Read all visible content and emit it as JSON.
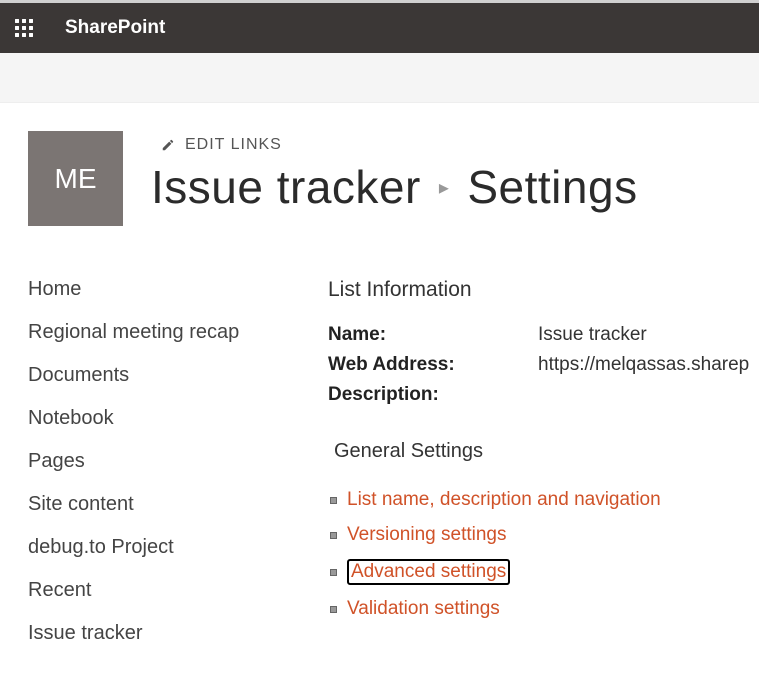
{
  "header": {
    "product_name": "SharePoint"
  },
  "site_logo_text": "ME",
  "edit_links_label": "EDIT LINKS",
  "page_title": {
    "list_name": "Issue tracker",
    "section": "Settings"
  },
  "sidebar": {
    "items": [
      {
        "label": "Home"
      },
      {
        "label": "Regional meeting recap"
      },
      {
        "label": "Documents"
      },
      {
        "label": "Notebook"
      },
      {
        "label": "Pages"
      },
      {
        "label": "Site content"
      },
      {
        "label": "debug.to Project"
      },
      {
        "label": "Recent"
      },
      {
        "label": "Issue tracker"
      }
    ]
  },
  "list_info": {
    "header": "List Information",
    "name_label": "Name:",
    "name_value": "Issue tracker",
    "web_label": "Web Address:",
    "web_value": "https://melqassas.sharep",
    "desc_label": "Description:"
  },
  "general_settings": {
    "header": "General Settings",
    "links": [
      {
        "label": "List name, description and navigation"
      },
      {
        "label": "Versioning settings"
      },
      {
        "label": "Advanced settings"
      },
      {
        "label": "Validation settings"
      }
    ]
  }
}
